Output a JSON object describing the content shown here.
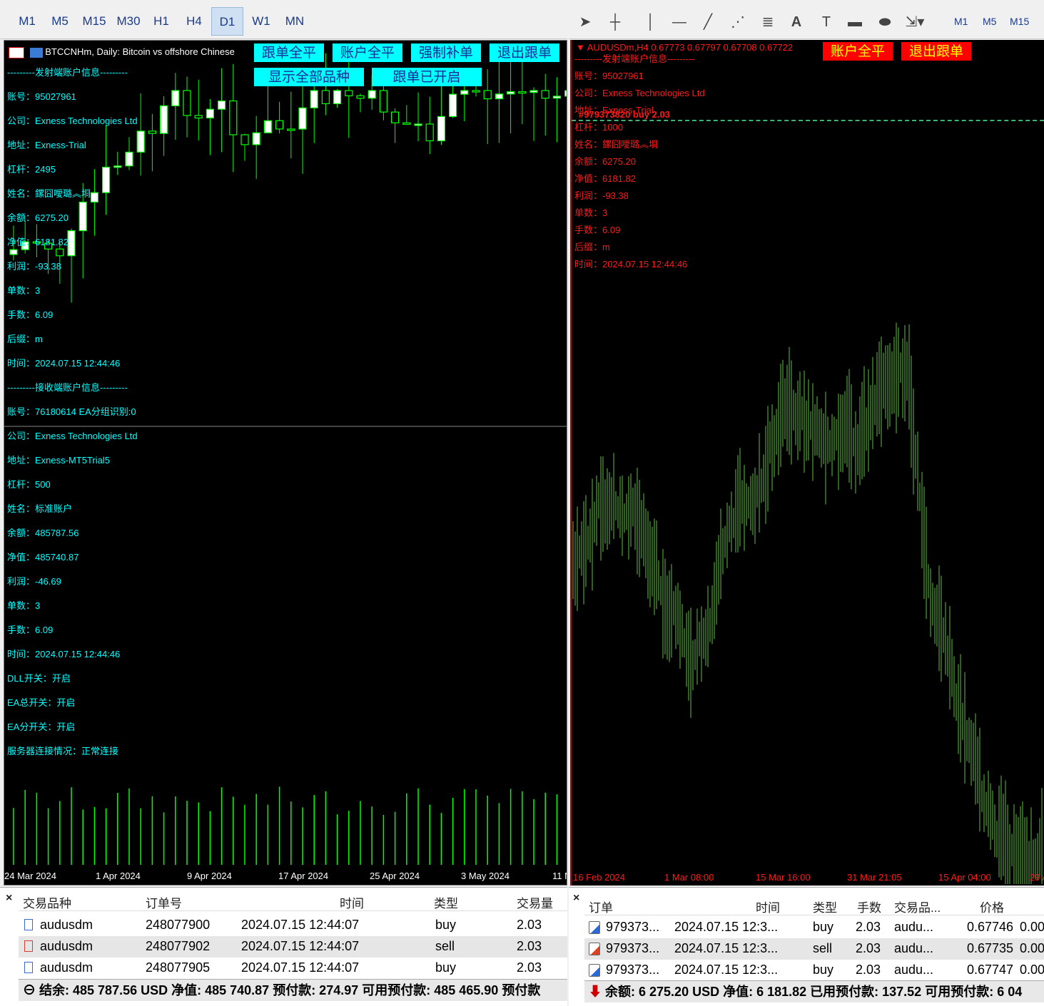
{
  "left_toolbar": {
    "timeframes": [
      "M1",
      "M5",
      "M15",
      "M30",
      "H1",
      "H4",
      "D1",
      "W1",
      "MN"
    ],
    "active": "D1"
  },
  "right_toolbar": {
    "tools": [
      "cursor-icon",
      "crosshair-icon",
      "vertical-line-icon",
      "horizontal-line-icon",
      "trendline-icon",
      "fibonacci-icon",
      "channel-icon",
      "text-icon",
      "label-icon",
      "rectangle-icon",
      "ellipse-icon",
      "arrows-icon"
    ],
    "timeframes": [
      "M1",
      "M5",
      "M15"
    ]
  },
  "left_chart": {
    "title": "BTCCNHm, Daily:  Bitcoin vs offshore Chinese",
    "buttons_row1": [
      "跟单全平",
      "账户全平",
      "强制补单",
      "退出跟单"
    ],
    "buttons_row2": [
      "显示全部品种",
      "跟单已开启"
    ],
    "info_lines": [
      "---------发射端账户信息---------",
      "账号：95027961",
      "公司：Exness Technologies Ltd",
      "地址：Exness-Trial",
      "杠杆：2495",
      "姓名：鏍囧噯璐︽埛",
      "余额：6275.20",
      "净值：6181.82",
      "利润：-93.38",
      "单数：3",
      "手数：6.09",
      "后缀：m",
      "时间：2024.07.15 12:44:46",
      "---------接收端账户信息---------",
      "账号：76180614 EA分组识别:0",
      "公司：Exness Technologies Ltd",
      "地址：Exness-MT5Trial5",
      "杠杆：500",
      "姓名：标准账户",
      "余额：485787.56",
      "净值：485740.87",
      "利润：-46.69",
      "单数：3",
      "手数：6.09",
      "时间：2024.07.15 12:44:46",
      "DLL开关：开启",
      "EA总开关：开启",
      "EA分开关：开启",
      "服务器连接情况：正常连接"
    ],
    "date_labels": [
      "24 Mar 2024",
      "1 Apr 2024",
      "9 Apr 2024",
      "17 Apr 2024",
      "25 Apr 2024",
      "3 May 2024",
      "11 M"
    ],
    "colors": {
      "candle": "#00ff00",
      "text": "#00ffff",
      "bg": "#000000"
    }
  },
  "right_chart": {
    "title": "AUDUSDm,H4  0.67773 0.67797 0.67708 0.67722",
    "buttons": [
      "账户全平",
      "退出跟单"
    ],
    "order_label": "#979373820 buy 2.03",
    "info_lines": [
      "---------发射端账户信息---------",
      "账号：95027961",
      "公司：Exness Technologies Ltd",
      "地址：Exness-Trial",
      "杠杆：1000",
      "姓名：鏍囧噯璐︽埛",
      "余额：6275.20",
      "净值：6181.82",
      "利润：-93.38",
      "单数：3",
      "手数：6.09",
      "后缀：m",
      "时间：2024.07.15 12:44:46"
    ],
    "date_labels": [
      "16 Feb 2024",
      "1 Mar 08:00",
      "15 Mar 16:00",
      "31 Mar 21:05",
      "15 Apr 04:00",
      "29 A"
    ],
    "colors": {
      "line": "#5fbf3f",
      "text": "#ff1a1a",
      "bg": "#000000"
    }
  },
  "left_panel": {
    "headers": [
      "交易品种",
      "订单号",
      "时间",
      "类型",
      "交易量"
    ],
    "rows": [
      {
        "symbol": "audusdm",
        "order": "248077900",
        "time": "2024.07.15 12:44:07",
        "type": "buy",
        "volume": "2.03"
      },
      {
        "symbol": "audusdm",
        "order": "248077902",
        "time": "2024.07.15 12:44:07",
        "type": "sell",
        "volume": "2.03"
      },
      {
        "symbol": "audusdm",
        "order": "248077905",
        "time": "2024.07.15 12:44:07",
        "type": "buy",
        "volume": "2.03"
      }
    ],
    "status": "结余: 485 787.56 USD  净值: 485 740.87  预付款: 274.97  可用预付款: 485 465.90  预付款"
  },
  "right_panel": {
    "headers": [
      "订单",
      "时间",
      "类型",
      "手数",
      "交易品...",
      "价格"
    ],
    "rows": [
      {
        "order": "979373...",
        "time": "2024.07.15 12:3...",
        "type": "buy",
        "lots": "2.03",
        "symbol": "audu...",
        "price": "0.67746",
        "extra": "0.00"
      },
      {
        "order": "979373...",
        "time": "2024.07.15 12:3...",
        "type": "sell",
        "lots": "2.03",
        "symbol": "audu...",
        "price": "0.67735",
        "extra": "0.00"
      },
      {
        "order": "979373...",
        "time": "2024.07.15 12:3...",
        "type": "buy",
        "lots": "2.03",
        "symbol": "audu...",
        "price": "0.67747",
        "extra": "0.00"
      }
    ],
    "status": "余额: 6 275.20 USD  净值: 6 181.82  已用预付款: 137.52  可用预付款: 6 04"
  }
}
